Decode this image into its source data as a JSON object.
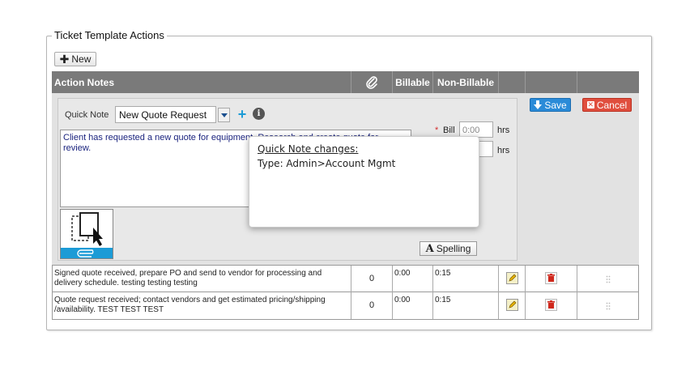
{
  "section": {
    "title": "Ticket Template Actions"
  },
  "toolbar": {
    "new_label": "New"
  },
  "grid": {
    "headers": {
      "action_notes": "Action Notes",
      "billable": "Billable",
      "non_billable": "Non-Billable"
    },
    "rows": [
      {
        "notes": "Signed quote received, prepare PO and send to vendor for processing and delivery schedule. testing testing testing",
        "attachments": "0",
        "billable": "0:00",
        "non_billable": "0:15"
      },
      {
        "notes": "Quote request received; contact vendors and get estimated pricing/shipping /availability. TEST TEST TEST",
        "attachments": "0",
        "billable": "0:00",
        "non_billable": "0:15"
      }
    ]
  },
  "editor": {
    "quick_note_label": "Quick Note",
    "quick_note_value": "New Quote Request",
    "info_glyph": "i",
    "notes_text": "Client has requested a new quote for equipment. Research and create quote for review.",
    "required_mark": "*",
    "bill_label": "Bill",
    "bill_placeholder": "0:00",
    "hrs_label": "hrs",
    "spelling_glyph": "A",
    "spelling_label": "Spelling",
    "save_label": "Save",
    "cancel_label": "Cancel"
  },
  "popup": {
    "title": "Quick Note changes:",
    "body": "Type: Admin>Account Mgmt"
  },
  "colors": {
    "header_bg": "#7a7a7a",
    "save": "#2b8bd8",
    "cancel": "#e04e3e",
    "accent": "#1c9bd6"
  }
}
